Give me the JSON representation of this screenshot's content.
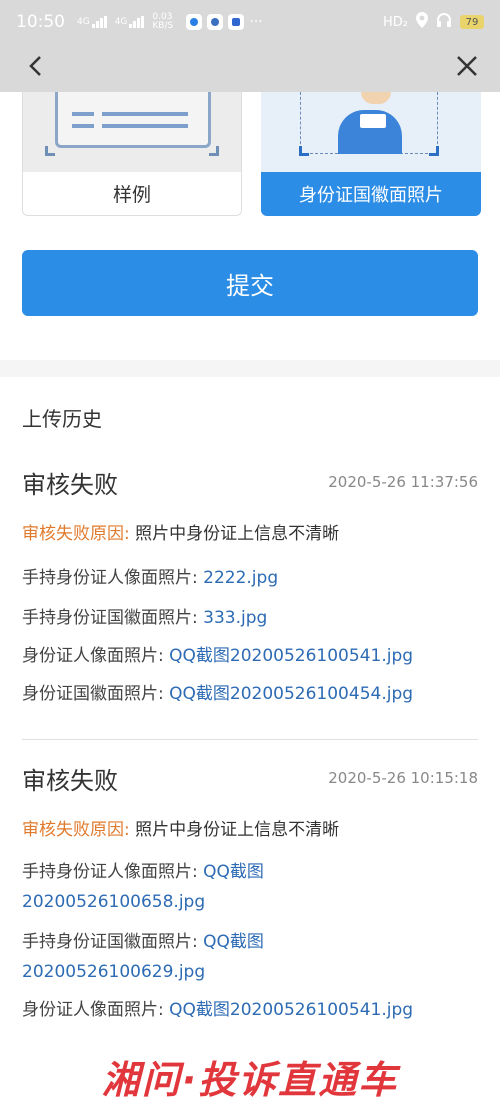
{
  "status_bar": {
    "time": "10:50",
    "net1": "4G",
    "net2": "4G",
    "speed": "0.03 KB/S",
    "hd": "HD₂",
    "battery": "79"
  },
  "nav": {
    "back_icon": "chevron-left-icon",
    "close_icon": "close-icon"
  },
  "upload": {
    "sample_label": "样例",
    "emblem_label": "身份证国徽面照片",
    "submit_label": "提交"
  },
  "history": {
    "title": "上传历史",
    "records": [
      {
        "status": "审核失败",
        "time": "2020-5-26 11:37:56",
        "reason_label": "审核失败原因:",
        "reason": "照片中身份证上信息不清晰",
        "rows": [
          {
            "label": "手持身份证人像面照片:",
            "file": "2222.jpg"
          },
          {
            "label": "手持身份证国徽面照片:",
            "file": "333.jpg"
          },
          {
            "label": "身份证人像面照片:",
            "file": "QQ截图20200526100541.jpg"
          },
          {
            "label": "身份证国徽面照片:",
            "file": "QQ截图20200526100454.jpg"
          }
        ]
      },
      {
        "status": "审核失败",
        "time": "2020-5-26 10:15:18",
        "reason_label": "审核失败原因:",
        "reason": "照片中身份证上信息不清晰",
        "rows": [
          {
            "label": "手持身份证人像面照片:",
            "file": "QQ截图",
            "file2": "20200526100658.jpg"
          },
          {
            "label": "手持身份证国徽面照片:",
            "file": "QQ截图",
            "file2": "20200526100629.jpg"
          },
          {
            "label": "身份证人像面照片:",
            "file": "QQ截图20200526100541.jpg"
          }
        ]
      }
    ]
  },
  "watermark": "湘问·投诉直通车",
  "colors": {
    "accent": "#2b8de6",
    "reason": "#e07a2c",
    "link": "#2d6bb4"
  }
}
